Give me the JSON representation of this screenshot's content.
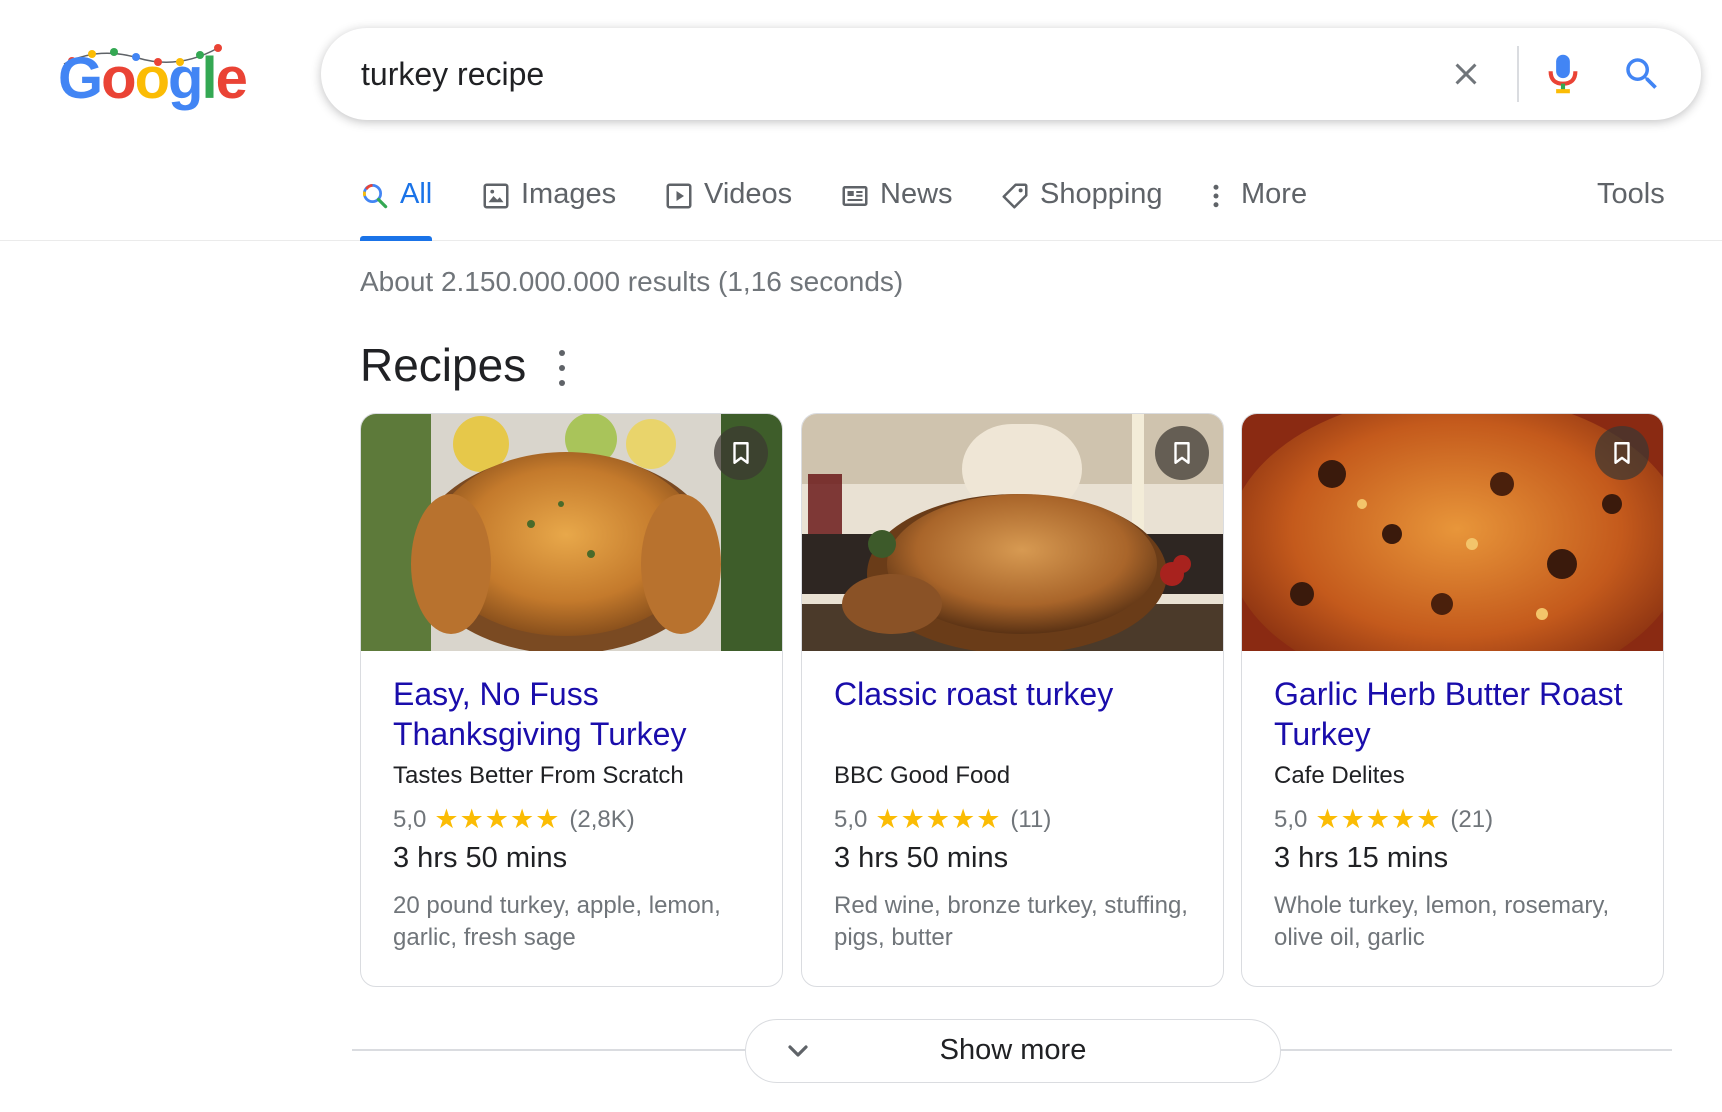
{
  "logo": {
    "letters": [
      "G",
      "o",
      "o",
      "g",
      "l",
      "e"
    ],
    "colors": [
      "#4285f4",
      "#ea4335",
      "#fbbc05",
      "#4285f4",
      "#34a853",
      "#ea4335"
    ]
  },
  "search": {
    "query": "turkey recipe",
    "clear_icon": "close-icon",
    "mic_icon": "microphone-icon",
    "search_icon": "search-icon"
  },
  "tabs": [
    {
      "label": "All",
      "icon": "search-icon",
      "active": true
    },
    {
      "label": "Images",
      "icon": "image-icon",
      "active": false
    },
    {
      "label": "Videos",
      "icon": "play-icon",
      "active": false
    },
    {
      "label": "News",
      "icon": "newspaper-icon",
      "active": false
    },
    {
      "label": "Shopping",
      "icon": "tag-icon",
      "active": false
    },
    {
      "label": "More",
      "icon": "more-vert-icon",
      "active": false
    }
  ],
  "tools_label": "Tools",
  "result_stats": "About 2.150.000.000 results (1,16 seconds)",
  "recipes": {
    "heading": "Recipes",
    "cards": [
      {
        "title": "Easy, No Fuss Thanksgiving Turkey",
        "source": "Tastes Better From Scratch",
        "rating": "5,0",
        "stars": 5,
        "reviews": "(2,8K)",
        "time": "3 hrs 50 mins",
        "ingredients": "20 pound turkey, apple, lemon, garlic, fresh sage"
      },
      {
        "title": "Classic roast turkey",
        "source": "BBC Good Food",
        "rating": "5,0",
        "stars": 5,
        "reviews": "(11)",
        "time": "3 hrs 50 mins",
        "ingredients": "Red wine, bronze turkey, stuffing, pigs, butter"
      },
      {
        "title": "Garlic Herb Butter Roast Turkey",
        "source": "Cafe Delites",
        "rating": "5,0",
        "stars": 5,
        "reviews": "(21)",
        "time": "3 hrs 15 mins",
        "ingredients": "Whole turkey, lemon, rosemary, olive oil, garlic"
      }
    ],
    "bookmark_icon": "bookmark-icon"
  },
  "show_more": {
    "label": "Show more",
    "icon": "chevron-down-icon"
  },
  "colors": {
    "accent": "#1a73e8",
    "link": "#1a0dab",
    "star": "#fbbc04",
    "muted": "#70757a"
  }
}
